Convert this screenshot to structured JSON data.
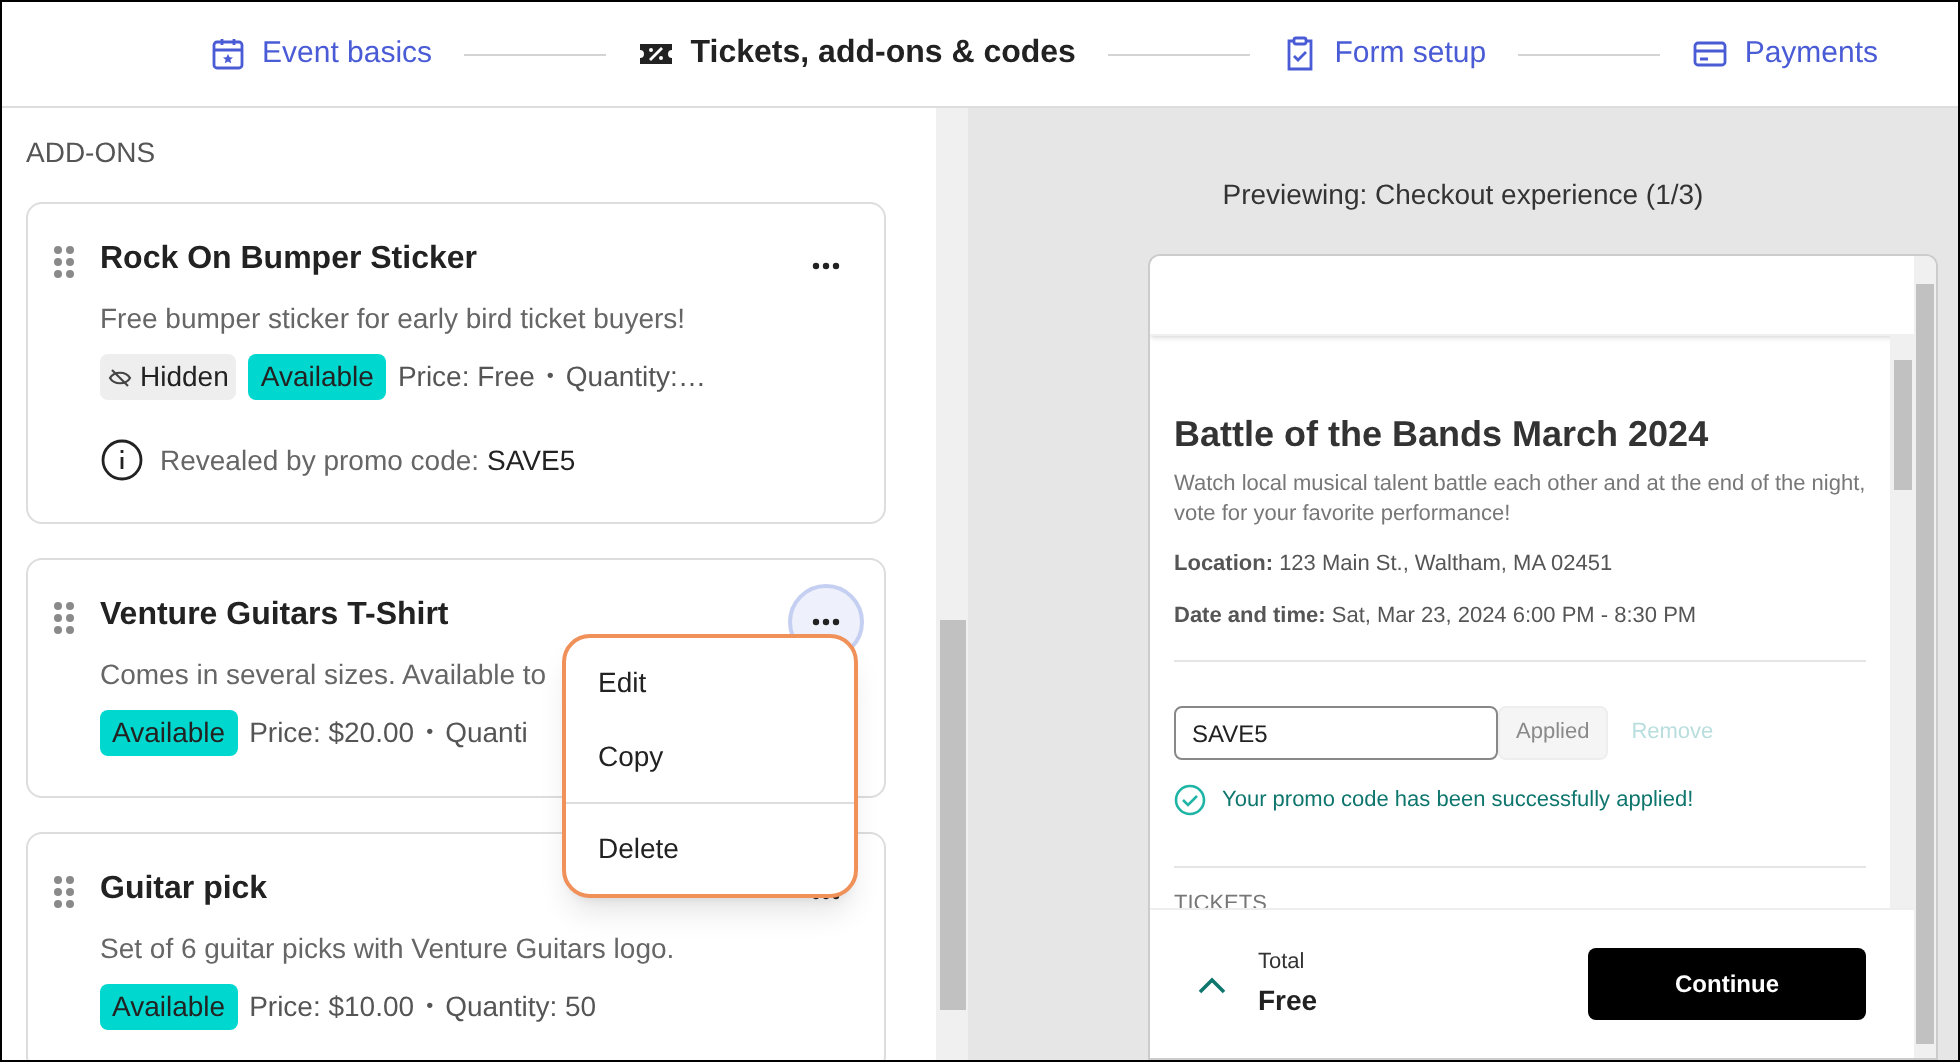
{
  "steps": [
    {
      "label": "Event basics",
      "selected": false
    },
    {
      "label": "Tickets, add-ons & codes",
      "selected": true
    },
    {
      "label": "Form setup",
      "selected": false
    },
    {
      "label": "Payments",
      "selected": false
    }
  ],
  "addons": {
    "heading": "ADD-ONS",
    "items": [
      {
        "title": "Rock On Bumper Sticker",
        "description": "Free bumper sticker for early bird ticket buyers!",
        "hidden_badge": "Hidden",
        "status": "Available",
        "price": "Price: Free",
        "separator": "•",
        "quantity": "Quantity:…",
        "note": "Revealed by promo code:",
        "note_code": "SAVE5",
        "menu_open": false
      },
      {
        "title": "Venture Guitars T-Shirt",
        "description": "Comes in several sizes. Available to",
        "status": "Available",
        "price": "Price: $20.00",
        "separator": "•",
        "quantity": "Quanti",
        "menu_open": true
      },
      {
        "title": "Guitar pick",
        "description": "Set of 6 guitar picks with Venture Guitars logo.",
        "status": "Available",
        "price": "Price: $10.00",
        "separator": "•",
        "quantity": "Quantity: 50",
        "menu_open": false
      }
    ]
  },
  "menu": {
    "items": [
      "Edit",
      "Copy",
      "Delete"
    ]
  },
  "preview": {
    "caption": "Previewing: Checkout experience (1/3)",
    "title": "Battle of the Bands March 2024",
    "description": "Watch local musical talent battle each other and at the end of the night, vote for your favorite performance!",
    "details": [
      {
        "label": "Location:",
        "value": "123 Main St., Waltham, MA 02451"
      },
      {
        "label": "Date and time:",
        "value": "Sat, Mar 23, 2024 6:00 PM - 8:30 PM"
      }
    ],
    "promo": {
      "value": "SAVE5",
      "apply_button": "Applied",
      "apply_disabled": true,
      "remove_link": "Remove",
      "message": "Your promo code has been successfully applied!"
    },
    "section": "TICKETS",
    "total_label": "Total",
    "total_value": "Free",
    "continue_button": "Continue"
  }
}
